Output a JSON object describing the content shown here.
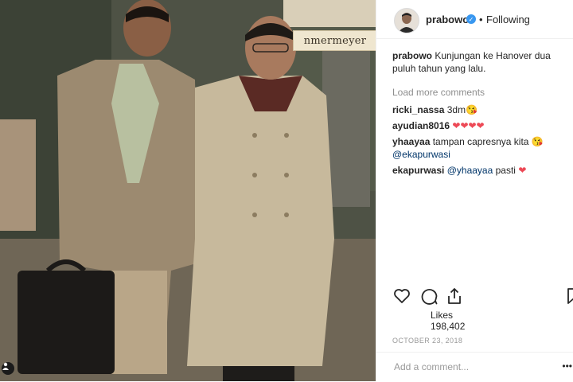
{
  "post": {
    "username": "prabowo",
    "follow_separator": "•",
    "follow_status": "Following",
    "caption_user": "prabowo",
    "caption_text": "Kunjungan ke Hanover dua puluh tahun yang lalu.",
    "load_more": "Load more comments",
    "comments": [
      {
        "user": "ricki_nassa",
        "text": "3dm",
        "emoji": "😘"
      },
      {
        "user": "ayudian8016",
        "text": "",
        "emoji": "❤❤❤❤"
      },
      {
        "user": "yhaayaa",
        "text": "tampan capresnya kita",
        "emoji": "😘",
        "mention": "@ekapurwasi"
      },
      {
        "user": "ekapurwasi",
        "mention": "@yhaayaa",
        "text": "pasti",
        "emoji": "❤"
      }
    ],
    "likes_label": "Likes",
    "likes_count": "198,402",
    "date": "OCTOBER 23, 2018",
    "add_comment_placeholder": "Add a comment...",
    "more_options": "•••",
    "photo_sign": "nmermeyer",
    "people_tag_icon": "person-icon"
  },
  "colors": {
    "verified": "#3897f0",
    "heart": "#ed4956",
    "mention": "#003569",
    "muted": "#8e8e8e"
  }
}
